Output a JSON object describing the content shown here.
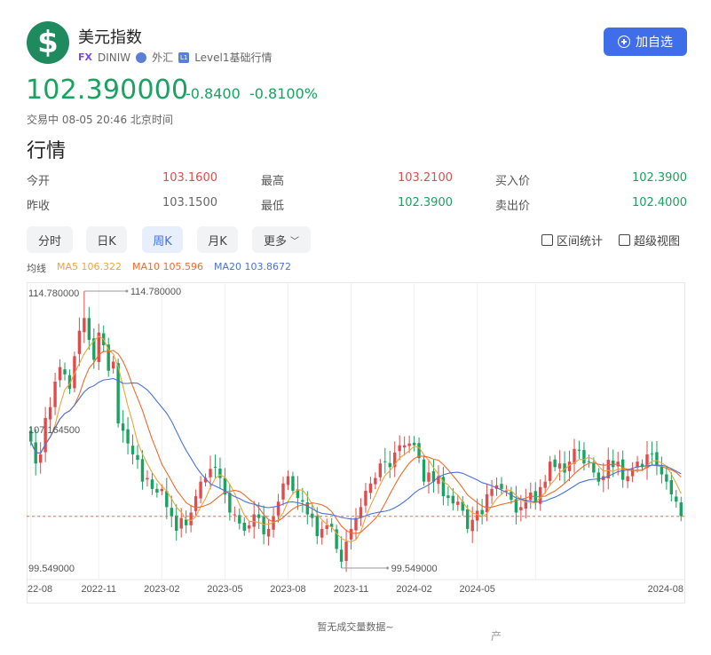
{
  "header": {
    "logo_symbol": "$",
    "title": "美元指数",
    "market_tag": "FX",
    "code": "DINIW",
    "category": "外汇",
    "level_tag": "L1",
    "level_label": "Level1基础行情",
    "add_button_label": "加自选"
  },
  "quote": {
    "price": "102.390000",
    "change": "-0.8400",
    "change_pct": "-0.8100%",
    "status": "交易中 08-05 20:46 北京时间"
  },
  "market_section_title": "行情",
  "stats": [
    {
      "label": "今开",
      "value": "103.1600",
      "color": "red"
    },
    {
      "label": "最高",
      "value": "103.2100",
      "color": "red"
    },
    {
      "label": "买入价",
      "value": "102.3900",
      "color": "green"
    },
    {
      "label": "昨收",
      "value": "103.1500",
      "color": "gray"
    },
    {
      "label": "最低",
      "value": "102.3900",
      "color": "green"
    },
    {
      "label": "卖出价",
      "value": "102.4000",
      "color": "green"
    }
  ],
  "tabs": [
    "分时",
    "日K",
    "周K",
    "月K",
    "更多"
  ],
  "active_tab": "周K",
  "tools": {
    "range_stats": "区间统计",
    "super_view": "超级视图"
  },
  "ma": {
    "label": "均线",
    "ma5": "MA5 106.322",
    "ma10": "MA10 105.596",
    "ma20": "MA20 103.8672"
  },
  "colors": {
    "up": "#e14b4b",
    "down": "#1aa260",
    "ma5": "#f2a33a",
    "ma10": "#f06a2a",
    "ma20": "#4a73d6",
    "accent": "#3f6ee8"
  },
  "chart_data": {
    "type": "candlestick",
    "y_labels": {
      "top": "114.780000",
      "mid": "107.164500",
      "bottom": "99.549000"
    },
    "high_marker": "114.780000",
    "low_marker": "99.549000",
    "last_price": 102.39,
    "ylim": [
      99.549,
      114.78
    ],
    "x_ticks": [
      "22-08",
      "2022-11",
      "2023-02",
      "2023-05",
      "2023-08",
      "2023-11",
      "2024-02",
      "2024-05",
      "2024-08"
    ],
    "x_tick_index": [
      0,
      14,
      27,
      40,
      53,
      66,
      79,
      92,
      104
    ],
    "closes": [
      106.5,
      105.3,
      105.8,
      107.8,
      108.4,
      109.8,
      110.6,
      110.2,
      109.4,
      111.2,
      112.6,
      113.3,
      112.1,
      111.0,
      112.5,
      111.8,
      110.4,
      110.9,
      107.5,
      107.1,
      106.4,
      105.8,
      105.5,
      104.3,
      104.5,
      103.9,
      103.7,
      103.9,
      102.9,
      102.4,
      101.6,
      102.3,
      101.9,
      102.6,
      103.5,
      104.3,
      104.5,
      105.0,
      105.1,
      104.5,
      103.6,
      102.6,
      102.5,
      102.0,
      101.6,
      101.9,
      102.5,
      102.3,
      101.4,
      101.7,
      102.4,
      103.2,
      104.2,
      104.6,
      103.8,
      103.4,
      103.2,
      102.5,
      102.3,
      101.3,
      101.7,
      101.9,
      101.8,
      100.6,
      99.9,
      101.0,
      101.7,
      102.3,
      102.9,
      103.8,
      104.2,
      104.5,
      105.3,
      105.4,
      105.1,
      105.9,
      106.3,
      106.3,
      106.4,
      106.3,
      105.6,
      104.3,
      104.8,
      104.3,
      104.6,
      103.5,
      103.4,
      103.1,
      103.2,
      102.7,
      101.7,
      102.2,
      102.7,
      102.5,
      103.6,
      103.9,
      104.1,
      103.9,
      103.8,
      103.3,
      102.6,
      102.9,
      103.3,
      103.7,
      103.2,
      104.0,
      104.3,
      105.4,
      105.1,
      105.3,
      104.8,
      105.4,
      106.1,
      106.0,
      105.3,
      105.4,
      104.8,
      104.3,
      104.6,
      105.5,
      105.1,
      105.4,
      104.4,
      104.6,
      105.0,
      105.4,
      105.1,
      105.8,
      105.8,
      105.2,
      104.7,
      104.3,
      103.6,
      103.2,
      102.4
    ]
  },
  "volume_note": "暂无成交量数据~",
  "watermark": "产"
}
